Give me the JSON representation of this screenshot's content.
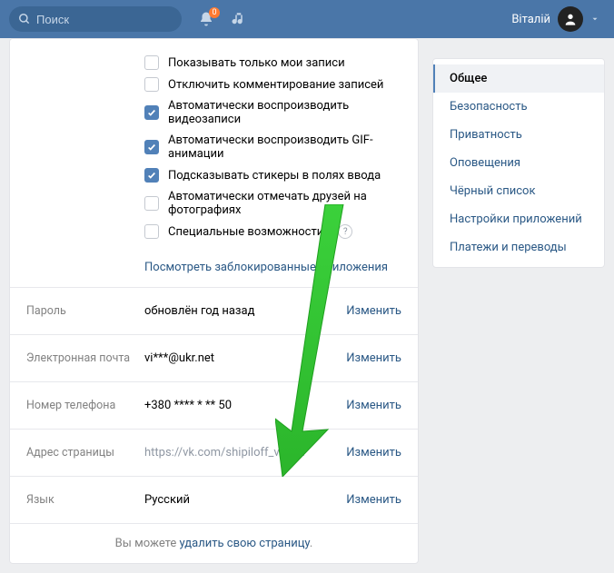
{
  "header": {
    "search_placeholder": "Поиск",
    "notif_badge": "0",
    "username": "Віталій"
  },
  "checks": [
    {
      "label": "Показывать только мои записи",
      "checked": false
    },
    {
      "label": "Отключить комментирование записей",
      "checked": false
    },
    {
      "label": "Автоматически воспроизводить видеозаписи",
      "checked": true
    },
    {
      "label": "Автоматически воспроизводить GIF-анимации",
      "checked": true
    },
    {
      "label": "Подсказывать стикеры в полях ввода",
      "checked": true
    },
    {
      "label": "Автоматически отмечать друзей на фотографиях",
      "checked": false
    },
    {
      "label": "Специальные возможности",
      "checked": false,
      "help": true
    }
  ],
  "blocked_apps_link": "Посмотреть заблокированные приложения",
  "rows": {
    "password": {
      "label": "Пароль",
      "value": "обновлён год назад",
      "action": "Изменить"
    },
    "email": {
      "label": "Электронная почта",
      "value": "vi***@ukr.net",
      "action": "Изменить"
    },
    "phone": {
      "label": "Номер телефона",
      "value": "+380 **** * ** 50",
      "action": "Изменить"
    },
    "address": {
      "label": "Адрес страницы",
      "value": "https://vk.com/shipiloff_vitalik",
      "action": "Изменить"
    },
    "language": {
      "label": "Язык",
      "value": "Русский",
      "action": "Изменить"
    }
  },
  "delete": {
    "prefix": "Вы можете ",
    "link": "удалить свою страницу",
    "suffix": "."
  },
  "sidebar": {
    "items": [
      {
        "label": "Общее",
        "active": true
      },
      {
        "label": "Безопасность"
      },
      {
        "label": "Приватность"
      },
      {
        "label": "Оповещения"
      },
      {
        "label": "Чёрный список"
      },
      {
        "label": "Настройки приложений"
      },
      {
        "label": "Платежи и переводы"
      }
    ]
  }
}
